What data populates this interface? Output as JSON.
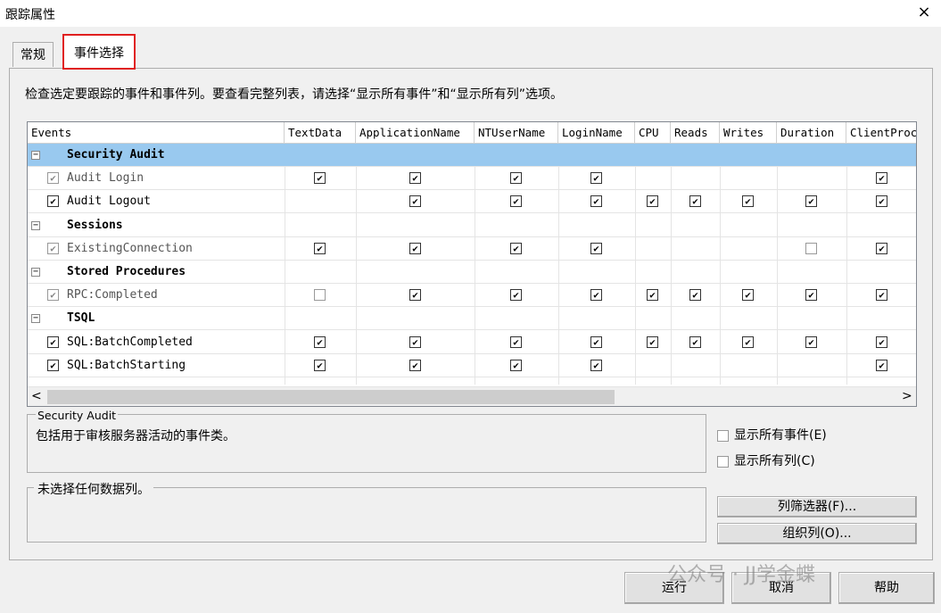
{
  "window": {
    "title": "跟踪属性",
    "close": "×"
  },
  "tabs": [
    {
      "label": "常规"
    },
    {
      "label": "事件选择"
    }
  ],
  "instructions": "检查选定要跟踪的事件和事件列。要查看完整列表，请选择“显示所有事件”和“显示所有列”选项。",
  "grid": {
    "columns": [
      "Events",
      "TextData",
      "ApplicationName",
      "NTUserName",
      "LoginName",
      "CPU",
      "Reads",
      "Writes",
      "Duration",
      "ClientProc"
    ],
    "rows": [
      {
        "type": "category",
        "name": "Security Audit",
        "expand": "−",
        "selected": true
      },
      {
        "type": "event",
        "name": "Audit Login",
        "checked": "✔",
        "disabled": true,
        "cells": [
          "✔",
          "✔",
          "✔",
          "✔",
          "",
          "",
          "",
          "",
          "✔"
        ]
      },
      {
        "type": "event",
        "name": "Audit Logout",
        "checked": "✔",
        "disabled": false,
        "cells": [
          "",
          "✔",
          "✔",
          "✔",
          "✔",
          "✔",
          "✔",
          "✔",
          "✔"
        ]
      },
      {
        "type": "category",
        "name": "Sessions",
        "expand": "−"
      },
      {
        "type": "event",
        "name": "ExistingConnection",
        "checked": "✔",
        "disabled": true,
        "cells": [
          "✔",
          "✔",
          "✔",
          "✔",
          "",
          "",
          "",
          "☐",
          "✔"
        ]
      },
      {
        "type": "category",
        "name": "Stored Procedures",
        "expand": "−"
      },
      {
        "type": "event",
        "name": "RPC:Completed",
        "checked": "✔",
        "disabled": true,
        "cells": [
          "☐",
          "✔",
          "✔",
          "✔",
          "✔",
          "✔",
          "✔",
          "✔",
          "✔"
        ]
      },
      {
        "type": "category",
        "name": "TSQL",
        "expand": "−"
      },
      {
        "type": "event",
        "name": "SQL:BatchCompleted",
        "checked": "✔",
        "disabled": false,
        "cells": [
          "✔",
          "✔",
          "✔",
          "✔",
          "✔",
          "✔",
          "✔",
          "✔",
          "✔"
        ]
      },
      {
        "type": "event",
        "name": "SQL:BatchStarting",
        "checked": "✔",
        "disabled": false,
        "cells": [
          "✔",
          "✔",
          "✔",
          "✔",
          "",
          "",
          "",
          "",
          "✔"
        ]
      }
    ],
    "scroll_left": "<",
    "scroll_right": ">"
  },
  "description": {
    "legend": "Security Audit",
    "text": "包括用于审核服务器活动的事件类。"
  },
  "columns_info": {
    "legend": "未选择任何数据列。"
  },
  "options": {
    "show_all_events": "显示所有事件(E)",
    "show_all_columns": "显示所有列(C)"
  },
  "buttons": {
    "column_filters": "列筛选器(F)...",
    "organize_columns": "组织列(O)...",
    "run": "运行",
    "cancel": "取消",
    "help": "帮助"
  },
  "watermark": "公众号 · JJ学金蝶"
}
